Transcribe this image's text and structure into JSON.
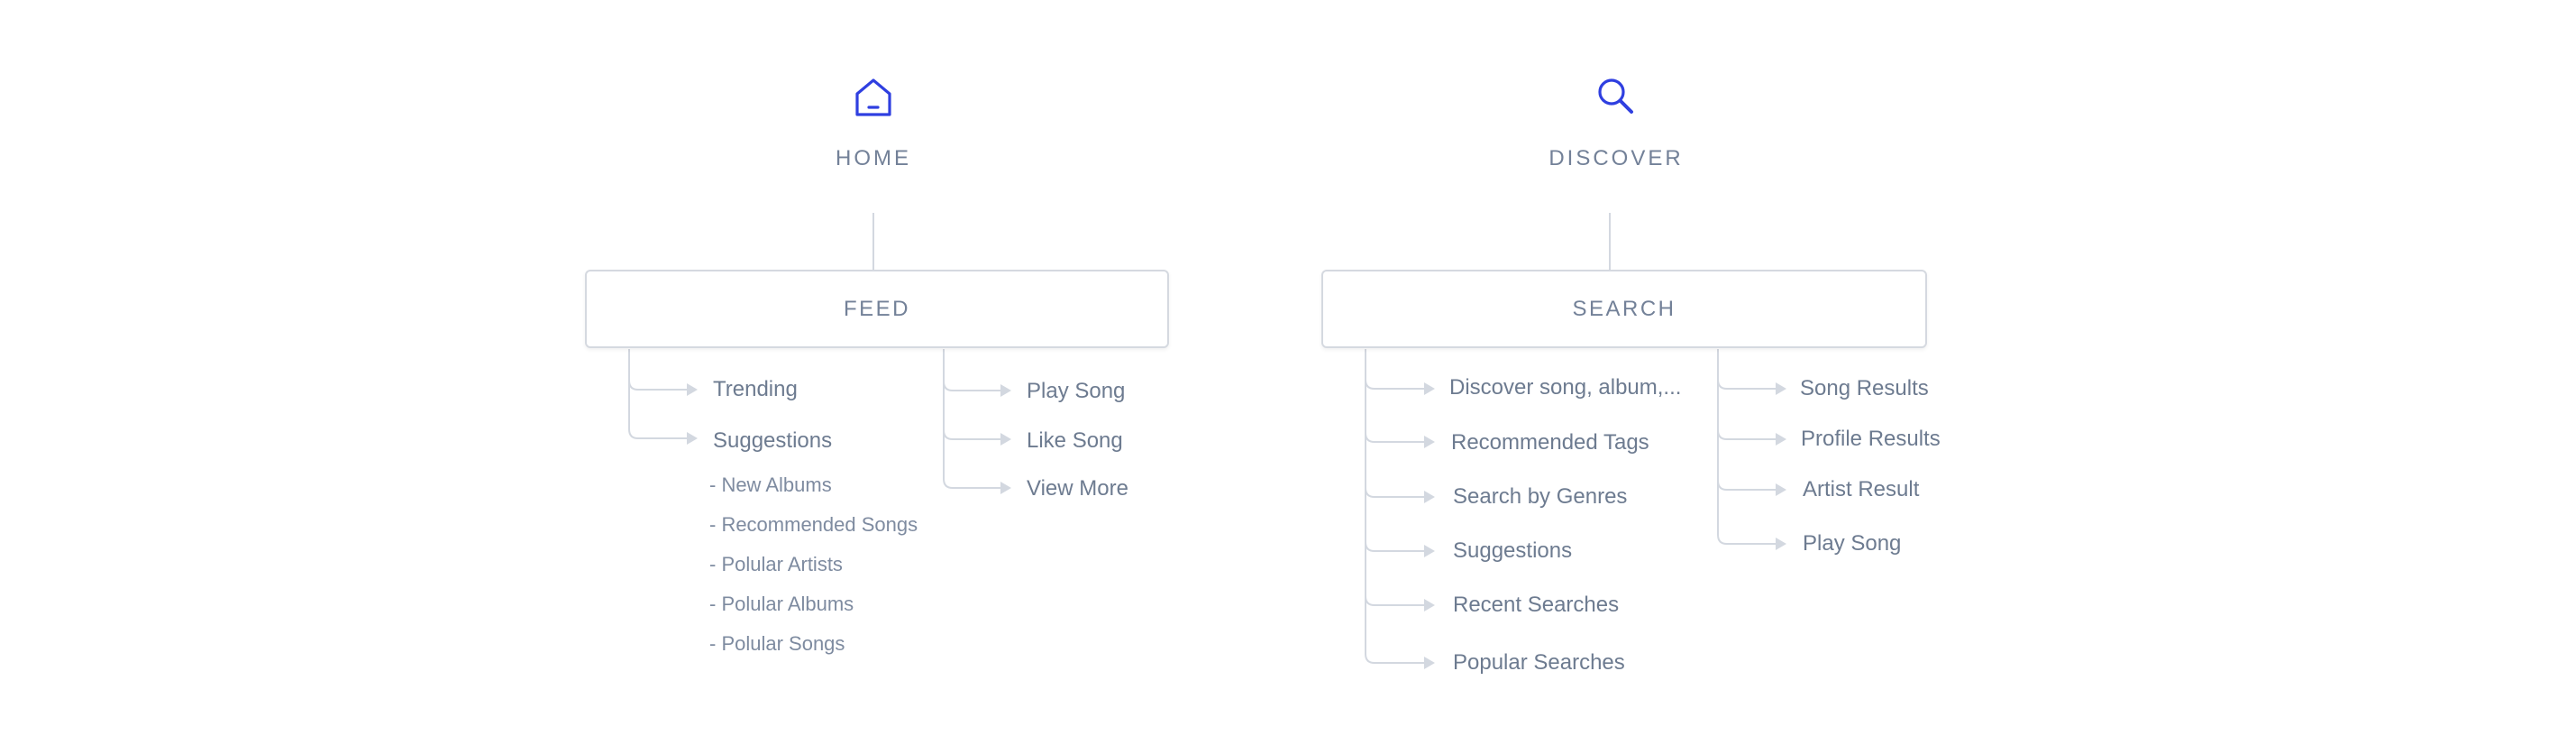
{
  "home": {
    "icon": "home-icon",
    "label": "HOME",
    "box_label": "FEED",
    "left_items": [
      "Trending",
      "Suggestions"
    ],
    "sub_items": [
      "- New Albums",
      "- Recommended Songs",
      "- Polular Artists",
      "- Polular Albums",
      "- Polular Songs"
    ],
    "right_items": [
      "Play Song",
      "Like Song",
      "View More"
    ]
  },
  "discover": {
    "icon": "search-icon",
    "label": "DISCOVER",
    "box_label": "SEARCH",
    "left_items": [
      "Discover song, album,...",
      "Recommended Tags",
      "Search by Genres",
      "Suggestions",
      "Recent Searches",
      "Popular Searches"
    ],
    "right_items": [
      "Song Results",
      "Profile Results",
      "Artist Result",
      "Play Song"
    ]
  },
  "colors": {
    "accent": "#2f3fe0",
    "line": "#d3d8e0",
    "text": "#6d7b90"
  }
}
